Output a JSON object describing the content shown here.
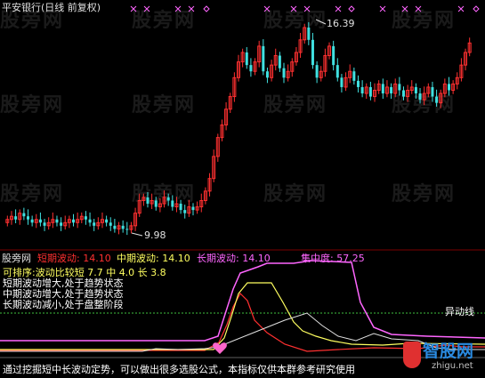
{
  "title": "平安银行(日线 前复权)",
  "watermarks": [
    "股旁网",
    "股旁网",
    "股旁网",
    "股旁网",
    "股旁网",
    "股旁网",
    "股旁网",
    "股旁网",
    "股旁网",
    "股旁网",
    "股旁网",
    "股旁网"
  ],
  "price_panel": {
    "high_label": "16.39",
    "low_label": "9.98",
    "colors": {
      "up": "#ff3030",
      "down": "#40e0e0",
      "marker": "#ff66ff"
    }
  },
  "indicator_header": {
    "name": "股旁网",
    "short_label": "短期波动: 14.10",
    "mid_label": "中期波动: 14.10",
    "long_label": "长期波动: 14.10",
    "focus_label": "集中度: 57.25",
    "colors": {
      "short": "#ff3030",
      "mid": "#ffff60",
      "long": "#ff66ff",
      "focus": "#ff66ff"
    }
  },
  "indicator_notes": [
    "可排序:波动比较短 7.7 中 4.0 长 3.8",
    "短期波动增大,处于趋势状态",
    "中期波动增大,处于趋势状态",
    "长期波动减小,处于盘整阶段"
  ],
  "anomaly_line_label": "异动线",
  "footer_text": "通过挖掘短中长波动定势，可以做出很多选股公式，本指标仅供本群参考研究使用",
  "logo": {
    "brand": "智股网",
    "url": "zhigu.net"
  },
  "chart_data": [
    {
      "type": "candlestick",
      "title": "平安银行(日线 前复权)",
      "annotations": [
        {
          "label": "16.39",
          "kind": "high"
        },
        {
          "label": "9.98",
          "kind": "low"
        }
      ],
      "close_series_approx": [
        10.3,
        10.4,
        10.3,
        10.5,
        10.4,
        10.3,
        10.2,
        10.3,
        10.2,
        10.1,
        10.2,
        10.3,
        10.2,
        10.1,
        10.2,
        10.3,
        10.2,
        10.3,
        10.4,
        10.3,
        10.2,
        10.1,
        10.2,
        10.3,
        10.2,
        10.1,
        10.0,
        10.1,
        10.0,
        9.98,
        10.1,
        10.5,
        10.9,
        11.0,
        10.8,
        10.9,
        10.7,
        10.8,
        11.0,
        10.9,
        10.7,
        10.8,
        10.6,
        10.5,
        10.7,
        10.6,
        10.7,
        10.9,
        11.2,
        11.6,
        12.3,
        12.9,
        13.3,
        13.8,
        14.2,
        14.8,
        15.3,
        15.6,
        15.2,
        15.0,
        15.3,
        15.8,
        15.0,
        14.8,
        15.2,
        15.5,
        15.1,
        14.8,
        15.0,
        15.3,
        15.6,
        16.0,
        16.39,
        16.0,
        15.2,
        14.8,
        15.0,
        15.5,
        15.8,
        15.2,
        14.8,
        14.5,
        14.8,
        15.0,
        14.7,
        14.5,
        14.3,
        14.5,
        14.2,
        14.4,
        14.6,
        14.3,
        14.5,
        14.3,
        14.6,
        14.4,
        14.2,
        14.4,
        14.5,
        14.3,
        14.1,
        14.3,
        14.5,
        14.2,
        14.0,
        14.3,
        14.6,
        14.4,
        14.6,
        14.8,
        15.2,
        15.6,
        15.9
      ]
    },
    {
      "type": "line",
      "series": [
        {
          "name": "短期波动",
          "last": 14.1
        },
        {
          "name": "中期波动",
          "last": 14.1
        },
        {
          "name": "长期波动",
          "last": 14.1
        },
        {
          "name": "集中度",
          "last": 57.25
        }
      ]
    }
  ]
}
